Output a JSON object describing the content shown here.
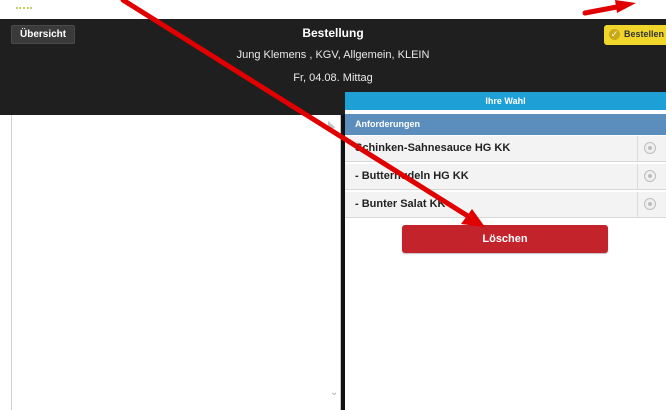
{
  "header": {
    "overview_label": "Übersicht",
    "title": "Bestellung",
    "subtitle": "Jung Klemens , KGV, Allgemein, KLEIN",
    "date": "Fr, 04.08. Mittag",
    "order_label": "Bestellen"
  },
  "right": {
    "choice_label": "Ihre Wahl",
    "requirements_label": "Anforderungen",
    "items": [
      {
        "label": "Schinken-Sahnesauce HG KK"
      },
      {
        "label": "- Butternudeln HG KK"
      },
      {
        "label": "- Bunter Salat KK"
      }
    ],
    "delete_label": "Löschen"
  },
  "colors": {
    "header_bg": "#1f1f1f",
    "accent_blue": "#1e9fd6",
    "section_blue": "#5b8ebd",
    "delete_red": "#c3232a",
    "order_yellow": "#f0d62b",
    "annotation_red": "#e00000"
  },
  "icons": {
    "order": "check-circle-icon",
    "item_option": "radio-circle-icon",
    "scroll": "chevron-down-icon"
  }
}
